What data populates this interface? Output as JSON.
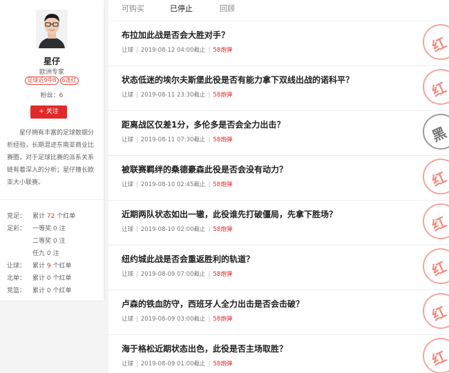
{
  "profile": {
    "name": "星仔",
    "title": "欧洲专家",
    "badges": [
      "足球近9中8",
      "6连红"
    ],
    "fans": "粉丝：6",
    "follow_label": "+ 关注",
    "bio": "星仔拥有丰富的足球数据分析经验，长期混迹东南亚商业比赛圈，对于足球比赛的派系关系链有着深入的分析；星仔擅长欧亚大小联赛。",
    "stats": [
      {
        "key": "竞足：",
        "prefix": "累计 ",
        "num": "72",
        "suffix": " 个红单"
      },
      {
        "key": "足彩：",
        "prefix": "一等奖 0 注",
        "num": "",
        "suffix": ""
      },
      {
        "key": "",
        "prefix": "二等奖 0 注",
        "num": "",
        "suffix": ""
      },
      {
        "key": "",
        "prefix": "任九 0 注",
        "num": "",
        "suffix": ""
      },
      {
        "key": "让球：",
        "prefix": "累计 ",
        "num": "9",
        "suffix": " 个红单"
      },
      {
        "key": "北单：",
        "prefix": "累计 0 个红单",
        "num": "",
        "suffix": ""
      },
      {
        "key": "竞篮：",
        "prefix": "累计 0 个红单",
        "num": "",
        "suffix": ""
      }
    ]
  },
  "tabs": [
    {
      "label": "可购买",
      "active": false
    },
    {
      "label": "已停止",
      "active": true
    },
    {
      "label": "回顾",
      "active": false
    }
  ],
  "articles": [
    {
      "title": "布拉加此战是否会大胜对手？",
      "type": "让球",
      "date": "2019-08-12 04:00截止",
      "price": "58炮弹",
      "stamp": "红",
      "stamp_color": "red"
    },
    {
      "title": "状态低迷的埃尔夫斯堡此役是否有能力拿下双线出战的诺科平？",
      "type": "让球",
      "date": "2019-08-11 23:30截止",
      "price": "58炮弹",
      "stamp": "红",
      "stamp_color": "red"
    },
    {
      "title": "距离战区仅差1分，多伦多是否会全力出击？",
      "type": "让球",
      "date": "2019-08-11 07:30截止",
      "price": "58炮弹",
      "stamp": "黑",
      "stamp_color": "black"
    },
    {
      "title": "被联赛羁绊的桑德豪森此役是否会没有动力？",
      "type": "让球",
      "date": "2019-08-10 02:45截止",
      "price": "58炮弹",
      "stamp": "红",
      "stamp_color": "red"
    },
    {
      "title": "近期两队状态如出一辙，此役谁先打破僵局，先拿下胜场？",
      "type": "让球",
      "date": "2019-08-10 02:00截止",
      "price": "58炮弹",
      "stamp": "红",
      "stamp_color": "red"
    },
    {
      "title": "纽约城此战是否会重返胜利的轨道？",
      "type": "让球",
      "date": "2019-08-09 07:00截止",
      "price": "58炮弹",
      "stamp": "红",
      "stamp_color": "red"
    },
    {
      "title": "卢森的铁血防守，西班牙人全力出击是否会击破？",
      "type": "让球",
      "date": "2019-08-09 03:00截止",
      "price": "58炮弹",
      "stamp": "红",
      "stamp_color": "red"
    },
    {
      "title": "海于格松近期状态出色，此役是否主场取胜？",
      "type": "让球",
      "date": "2019-08-09 01:00截止",
      "price": "58炮弹",
      "stamp": "红",
      "stamp_color": "red"
    }
  ]
}
